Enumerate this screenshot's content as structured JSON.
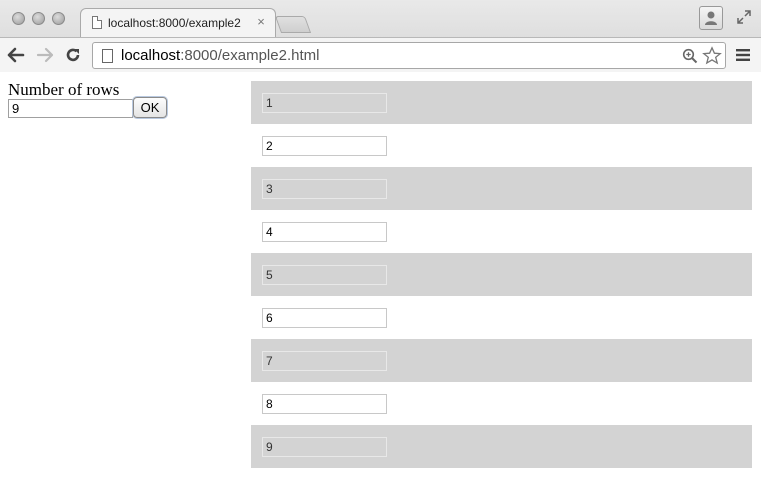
{
  "browser": {
    "tab": {
      "title": "localhost:8000/example2",
      "close_label": "×"
    },
    "omnibox": {
      "host": "localhost",
      "rest": ":8000/example2.html"
    }
  },
  "form": {
    "label": "Number of rows",
    "rows_value": "9",
    "ok_label": "OK"
  },
  "rows": [
    "1",
    "2",
    "3",
    "4",
    "5",
    "6",
    "7",
    "8",
    "9"
  ]
}
